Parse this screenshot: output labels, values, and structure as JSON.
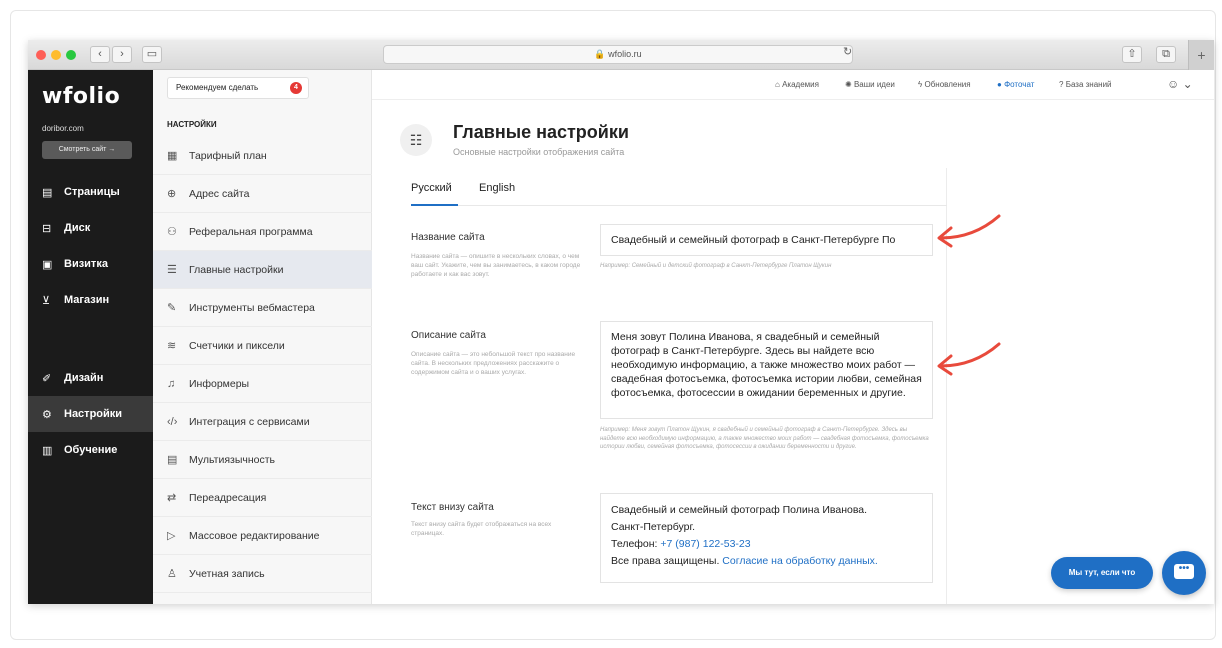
{
  "browser": {
    "url": "wfolio.ru"
  },
  "sidebar": {
    "logo": "wfolio",
    "domain": "doribor.com",
    "view_site": "Смотреть сайт →",
    "items": [
      {
        "label": "Страницы",
        "icon": "file-icon"
      },
      {
        "label": "Диск",
        "icon": "disk-icon"
      },
      {
        "label": "Визитка",
        "icon": "card-icon"
      },
      {
        "label": "Магазин",
        "icon": "cart-icon"
      },
      {
        "label": "Дизайн",
        "icon": "brush-icon"
      },
      {
        "label": "Настройки",
        "icon": "gear-icon"
      },
      {
        "label": "Обучение",
        "icon": "book-icon"
      }
    ]
  },
  "submenu": {
    "recommend": "Рекомендуем сделать",
    "recommend_count": "4",
    "heading": "НАСТРОЙКИ",
    "items": [
      {
        "label": "Тарифный план"
      },
      {
        "label": "Адрес сайта"
      },
      {
        "label": "Реферальная программа"
      },
      {
        "label": "Главные настройки"
      },
      {
        "label": "Инструменты вебмастера"
      },
      {
        "label": "Счетчики и пиксели"
      },
      {
        "label": "Информеры"
      },
      {
        "label": "Интеграция с сервисами"
      },
      {
        "label": "Мультиязычность"
      },
      {
        "label": "Переадресация"
      },
      {
        "label": "Массовое редактирование"
      },
      {
        "label": "Учетная запись"
      }
    ]
  },
  "topnav": {
    "academy": "Академия",
    "ideas": "Ваши идеи",
    "updates": "Обновления",
    "photochat": "Фоточат",
    "knowledge": "База знаний"
  },
  "main": {
    "title": "Главные настройки",
    "subtitle": "Основные настройки отображения сайта",
    "tabs": [
      "Русский",
      "English"
    ],
    "fields": [
      {
        "label": "Название сайта",
        "help": "Название сайта — опишите в нескольких словах, о чем ваш сайт. Укажите, чем вы занимаетесь, в каком городе работаете и как вас зовут.",
        "value": "Свадебный и семейный фотограф в Санкт-Петербурге По",
        "hint": "Например: Семейный и детский фотограф в Санкт-Петербурге Платон Щукин"
      },
      {
        "label": "Описание сайта",
        "help": "Описание сайта — это небольшой текст про название сайта. В нескольких предложениях расскажите о содержимом сайта и о ваших услугах.",
        "value": "Меня зовут Полина Иванова, я свадебный и семейный фотограф в Санкт-Петербурге. Здесь вы найдете всю необходимую информацию, а также множество моих работ — свадебная фотосъемка, фотосъемка истории любви, семейная фотосъемка, фотосессии в ожидании беременных и другие.",
        "hint": "Например: Меня зовут Платон Щукин, я свадебный и семейный фотограф в Санкт-Петербурге. Здесь вы найдете всю необходимую информацию, а также множество моих работ — свадебная фотосъемка, фотосъемка истории любви, семейная фотосъемка, фотосессии в ожидании беременности и другие."
      },
      {
        "label": "Текст внизу сайта",
        "help": "Текст внизу сайта будет отображаться на всех страницах.",
        "line1": "Свадебный и семейный фотограф Полина Иванова.",
        "line2": "Санкт-Петербург.",
        "phone_label": "Телефон: ",
        "phone": "+7 (987) 122-53-23",
        "rights": "Все права защищены. ",
        "consent": "Согласие на обработку данных."
      }
    ]
  },
  "chat": {
    "pill": "Мы тут, если что"
  },
  "colors": {
    "accent": "#1f6fc5",
    "sidebar": "#1b1b1b",
    "arrow": "#e84a3c"
  }
}
